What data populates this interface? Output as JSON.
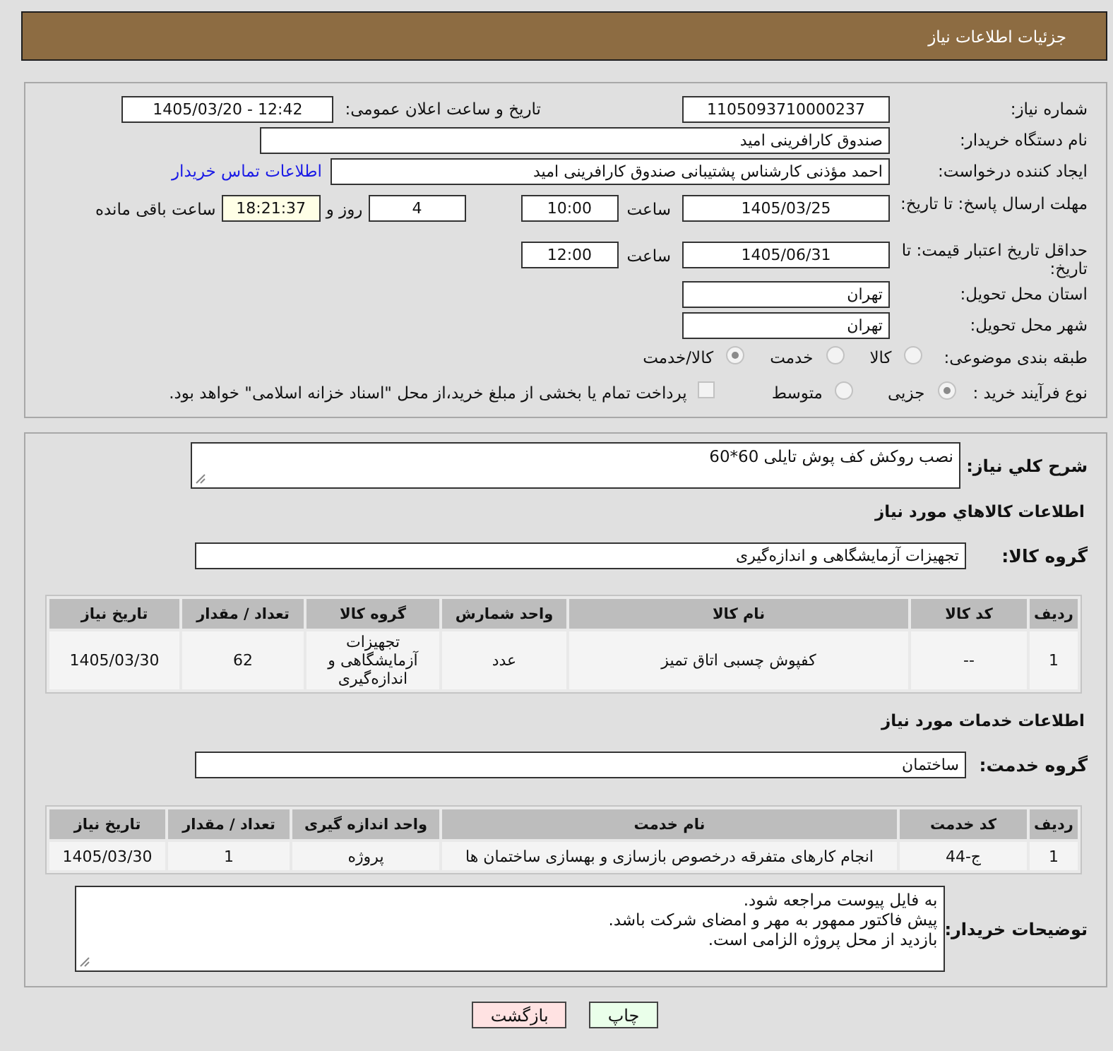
{
  "header": {
    "title": "جزئیات اطلاعات نیاز"
  },
  "need_info": {
    "need_number": {
      "label": "شماره نیاز:",
      "value": "1105093710000237"
    },
    "announce_datetime": {
      "label": "تاریخ و ساعت اعلان عمومی:",
      "value": "1405/03/20 - 12:42"
    },
    "buyer_org": {
      "label": "نام دستگاه خریدار:",
      "value": "صندوق کارافرینی امید"
    },
    "requester": {
      "label": "ایجاد کننده درخواست:",
      "value": "احمد مؤذنی کارشناس پشتیبانی صندوق کارافرینی امید",
      "contact_link": "اطلاعات تماس خریدار"
    },
    "response_deadline": {
      "label": "مهلت ارسال پاسخ: تا تاریخ:",
      "date": "1405/03/25",
      "time_label": "ساعت",
      "time": "10:00",
      "days": "4",
      "days_label": "روز و",
      "remaining": "18:21:37",
      "remaining_label": "ساعت باقی مانده"
    },
    "price_validity": {
      "label": "حداقل تاریخ اعتبار قیمت: تا تاریخ:",
      "date": "1405/06/31",
      "time_label": "ساعت",
      "time": "12:00"
    },
    "delivery_province": {
      "label": "استان محل تحویل:",
      "value": "تهران"
    },
    "delivery_city": {
      "label": "شهر محل تحویل:",
      "value": "تهران"
    },
    "category": {
      "label": "طبقه بندی موضوعی:",
      "options": [
        {
          "label": "کالا",
          "selected": false
        },
        {
          "label": "خدمت",
          "selected": false
        },
        {
          "label": "کالا/خدمت",
          "selected": true
        }
      ]
    },
    "purchase_type": {
      "label": "نوع فرآیند خرید :",
      "options": [
        {
          "label": "جزیی",
          "selected": true
        },
        {
          "label": "متوسط",
          "selected": false
        }
      ],
      "treasury": {
        "label": "پرداخت تمام یا بخشی از مبلغ خرید،از محل \"اسناد خزانه اسلامی\" خواهد بود.",
        "checked": false
      }
    }
  },
  "description": {
    "label": "شرح کلي نیاز:",
    "value": "نصب روکش کف پوش تایلی 60*60"
  },
  "goods": {
    "title": "اطلاعات کالاهاي مورد نیاز",
    "group_label": "گروه کالا:",
    "group": "تجهیزات آزمایشگاهی و اندازه‌گیری",
    "table": {
      "columns": [
        "ردیف",
        "کد کالا",
        "نام کالا",
        "واحد شمارش",
        "گروه کالا",
        "تعداد / مقدار",
        "تاریخ نیاز"
      ],
      "rows": [
        [
          "1",
          "--",
          "کفپوش چسبی اتاق تمیز",
          "عدد",
          "تجهیزات آزمایشگاهی و اندازه‌گیری",
          "62",
          "1405/03/30"
        ]
      ]
    }
  },
  "services": {
    "title": "اطلاعات خدمات مورد نیاز",
    "group_label": "گروه خدمت:",
    "group": "ساختمان",
    "table": {
      "columns": [
        "ردیف",
        "کد خدمت",
        "نام خدمت",
        "واحد اندازه گیری",
        "تعداد / مقدار",
        "تاریخ نیاز"
      ],
      "rows": [
        [
          "1",
          "ج-44",
          "انجام کارهای متفرقه درخصوص بازسازی و بهسازی ساختمان ها",
          "پروژه",
          "1",
          "1405/03/30"
        ]
      ]
    }
  },
  "buyer_notes": {
    "label": "توضیحات خریدار:",
    "value": "به فایل پیوست مراجعه شود.\nپیش فاکتور ممهور به مهر و امضای شرکت باشد.\nبازدید از محل پروژه الزامی است."
  },
  "buttons": [
    {
      "label": "چاپ",
      "kind": "print"
    },
    {
      "label": "بازگشت",
      "kind": "back"
    }
  ]
}
